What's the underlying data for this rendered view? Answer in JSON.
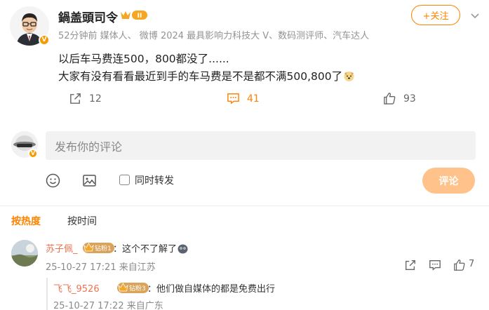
{
  "post": {
    "username": "鍋盖頭司令",
    "vip_badge": "II",
    "meta": "52分钟前 媒体人、 微博 2024 最具影响力科技大 V、数码测评师、汽车达人",
    "follow_label": "+关注",
    "text_line1": "以后车马费连500，800都没了......",
    "text_line2": "大家有没有看看最近到手的车马费是不是都不满500,800了",
    "repost_count": "12",
    "comment_count": "41",
    "like_count": "93"
  },
  "composer": {
    "placeholder": "发布你的评论",
    "repost_label": "同时转发",
    "submit_label": "评论"
  },
  "sort": {
    "hot": "按热度",
    "time": "按时间"
  },
  "comments": [
    {
      "name": "苏子佩_",
      "badge": "钻粉1",
      "text": "：这个不了解了",
      "meta": "25-10-27 17:21 来自江苏",
      "like_count": "7"
    }
  ],
  "replies": [
    {
      "name": "飞飞_9526",
      "badge": "钻粉3",
      "text": "：他们做自媒体的都是免费出行",
      "meta": "25-10-27 17:22 来自广东"
    }
  ],
  "colors": {
    "accent": "#ff8200",
    "name_link": "#eb7350",
    "muted": "#939393"
  }
}
